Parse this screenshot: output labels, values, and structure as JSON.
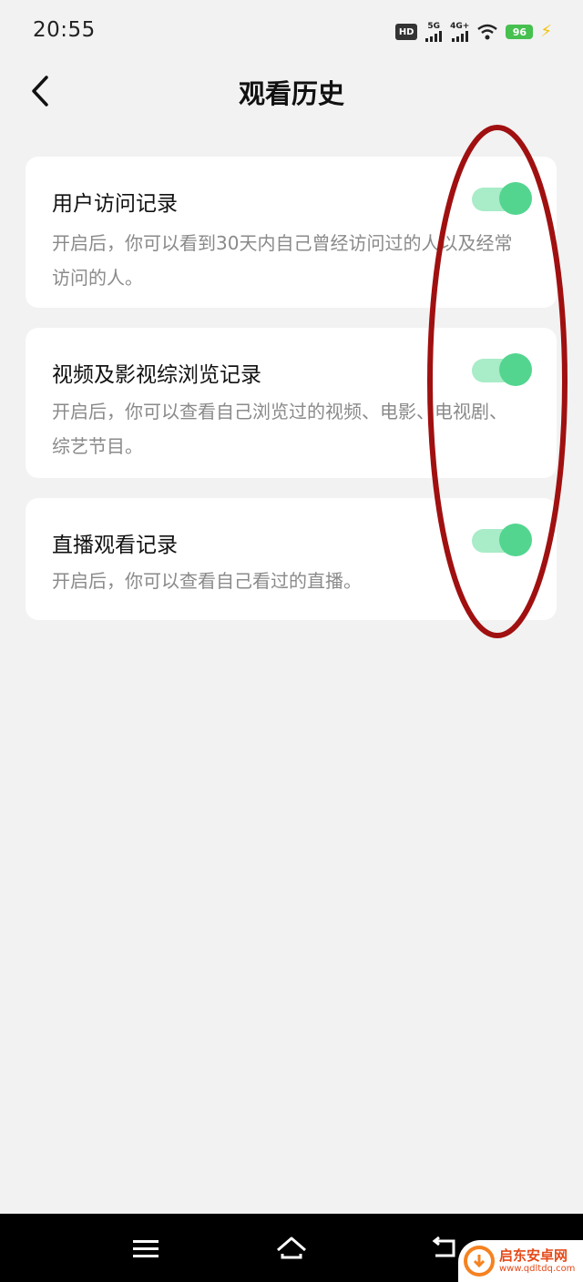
{
  "status_bar": {
    "time": "20:55",
    "hd": "HD",
    "signal1": "5G",
    "signal2": "4G+",
    "battery": "96"
  },
  "header": {
    "title": "观看历史",
    "back_icon": "chevron-left-icon"
  },
  "settings": [
    {
      "title": "用户访问记录",
      "description": "开启后，你可以看到30天内自己曾经访问过的人以及经常访问的人。",
      "enabled": true
    },
    {
      "title": "视频及影视综浏览记录",
      "description": "开启后，你可以查看自己浏览过的视频、电影、电视剧、综艺节目。",
      "enabled": true
    },
    {
      "title": "直播观看记录",
      "description": "开启后，你可以查看自己看过的直播。",
      "enabled": true
    }
  ],
  "nav_bar": {
    "menu_icon": "menu-icon",
    "home_icon": "home-icon",
    "back_icon": "back-icon"
  },
  "watermark": {
    "name": "启东安卓网",
    "url": "www.qdltdq.com"
  },
  "colors": {
    "toggle_on_track": "#a8ecc8",
    "toggle_on_knob": "#53d58f",
    "annotation": "#a01010"
  }
}
